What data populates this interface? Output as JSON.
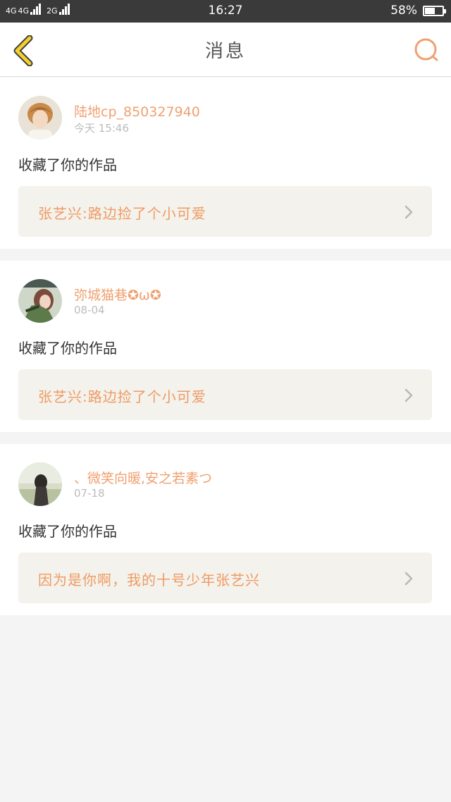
{
  "status_bar": {
    "network_1": "4G",
    "network_2": "4G",
    "network_3": "2G",
    "time": "16:27",
    "battery_percent_text": "58%",
    "battery_level": 0.58
  },
  "header": {
    "title": "消息"
  },
  "colors": {
    "accent": "#f0a070",
    "back_arrow": "#f2d02e",
    "work_bg": "#f3f2ec"
  },
  "messages": [
    {
      "username": "陆地cp_850327940",
      "time": "今天 15:46",
      "action": "收藏了你的作品",
      "work_title": "张艺兴:路边捡了个小可爱"
    },
    {
      "username": "弥城猫巷✪ω✪",
      "time": "08-04",
      "action": "收藏了你的作品",
      "work_title": "张艺兴:路边捡了个小可爱"
    },
    {
      "username": "、微笑向暖,安之若素つ",
      "time": "07-18",
      "action": "收藏了你的作品",
      "work_title": "因为是你啊，我的十号少年张艺兴"
    }
  ],
  "icons": {
    "back": "chevron-left-icon",
    "search": "search-icon",
    "chevron": "chevron-right-icon"
  }
}
